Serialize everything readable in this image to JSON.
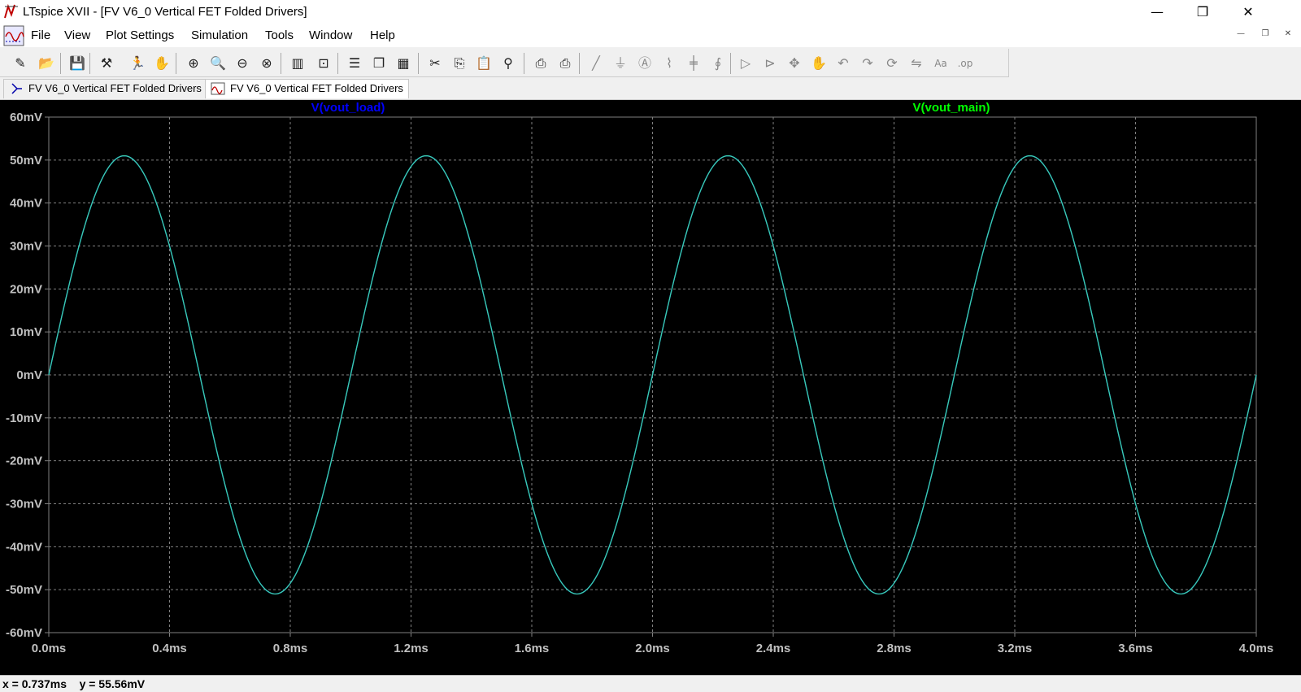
{
  "window": {
    "title": "LTspice XVII - [FV V6_0 Vertical FET Folded Drivers]",
    "minimize": "—",
    "maximize": "❐",
    "close": "✕"
  },
  "menu": {
    "items": [
      "File",
      "View",
      "Plot Settings",
      "Simulation",
      "Tools",
      "Window",
      "Help"
    ],
    "mdi_minimize": "—",
    "mdi_restore": "❐",
    "mdi_close": "✕"
  },
  "toolbar": {
    "buttons": [
      "new-schematic-icon",
      "open-folder-icon",
      "save-icon",
      "control-panel-icon",
      "run-icon",
      "halt-icon",
      "zoom-area-icon",
      "zoom-in-icon",
      "zoom-out-icon",
      "zoom-cancel-icon",
      "autorange-icon",
      "fit-icon",
      "tile-horizontal-icon",
      "cascade-icon",
      "tile-vertical-icon",
      "cut-icon",
      "copy-icon",
      "paste-icon",
      "find-icon",
      "print-icon",
      "print-preview-icon",
      "wire-icon",
      "ground-icon",
      "label-icon",
      "resistor-icon",
      "capacitor-icon",
      "inductor-icon",
      "diode-icon",
      "component-icon",
      "move-icon",
      "drag-icon",
      "undo-icon",
      "redo-icon",
      "rotate-icon",
      "mirror-icon",
      "text-icon",
      "spice-directive-icon"
    ]
  },
  "tabs": [
    {
      "label": "FV V6_0 Vertical FET Folded Drivers",
      "icon": "schematic-icon",
      "active": false
    },
    {
      "label": "FV V6_0 Vertical FET Folded Drivers",
      "icon": "waveform-icon",
      "active": true
    }
  ],
  "colors": {
    "plot_bg": "#000000",
    "grid": "#808080",
    "axis_text": "#c0c0c0",
    "trace_load": "#0000ff",
    "trace_main": "#00ff00",
    "trace_visible": "#40d0a0"
  },
  "chart_data": {
    "type": "line",
    "xlabel": "",
    "ylabel": "",
    "xlim": [
      0,
      4.0
    ],
    "ylim": [
      -60,
      60
    ],
    "x_ticks": [
      "0.0ms",
      "0.4ms",
      "0.8ms",
      "1.2ms",
      "1.6ms",
      "2.0ms",
      "2.4ms",
      "2.8ms",
      "3.2ms",
      "3.6ms",
      "4.0ms"
    ],
    "y_ticks": [
      "60mV",
      "50mV",
      "40mV",
      "30mV",
      "20mV",
      "10mV",
      "0mV",
      "-10mV",
      "-20mV",
      "-30mV",
      "-40mV",
      "-50mV",
      "-60mV"
    ],
    "x_unit": "ms",
    "y_unit": "mV",
    "series": [
      {
        "name": "V(vout_load)",
        "color": "#0000ff",
        "amplitude": 51,
        "period_ms": 1.0,
        "phase_deg": 0
      },
      {
        "name": "V(vout_main)",
        "color": "#00ff00",
        "amplitude": 51,
        "period_ms": 1.0,
        "phase_deg": 0
      }
    ],
    "grid": true
  },
  "status": {
    "cursor_readout": "x = 0.737ms    y = 55.56mV"
  }
}
